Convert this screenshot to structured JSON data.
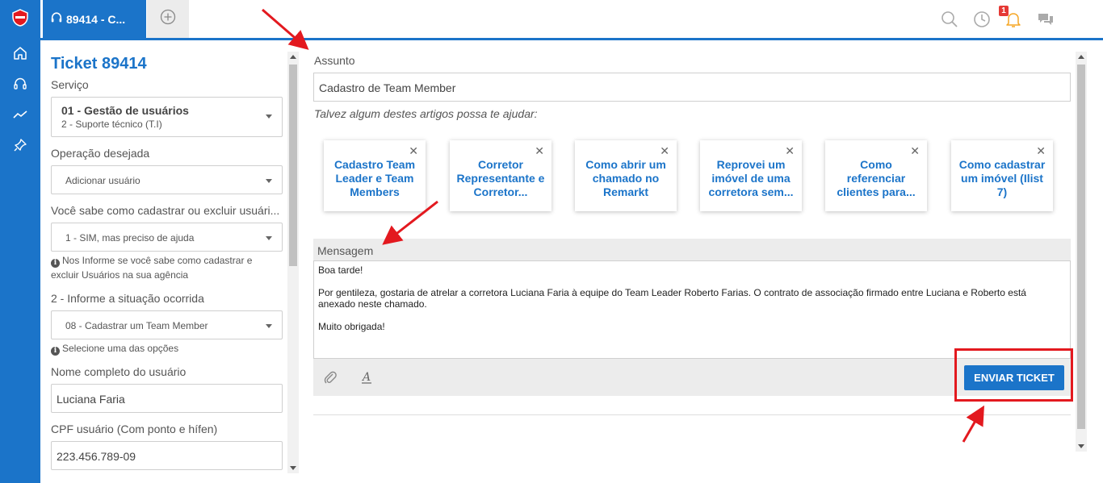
{
  "colors": {
    "brand": "#1b74c9",
    "annotation": "#e3191f",
    "badge": "#e53935"
  },
  "rail": {
    "items": [
      {
        "name": "home-icon"
      },
      {
        "name": "headset-icon"
      },
      {
        "name": "trending-icon"
      },
      {
        "name": "pin-icon"
      }
    ]
  },
  "tabs": {
    "active_label": "89414 - C...",
    "add_icon": "plus-circle-icon"
  },
  "header": {
    "icons": [
      "search-icon",
      "clock-icon",
      "bell-icon",
      "chat-icon"
    ],
    "notification_count": "1"
  },
  "form": {
    "title": "Ticket 89414",
    "servico_label": "Serviço",
    "servico_value": "01 - Gestão de usuários",
    "servico_sub": "2 - Suporte técnico (T.I)",
    "operacao_label": "Operação desejada",
    "operacao_value": "Adicionar usuário",
    "sabe_label": "Você sabe como cadastrar ou excluir usuári...",
    "sabe_value": "1 - SIM, mas preciso de ajuda",
    "sabe_hint": "Nos Informe se você sabe como cadastrar e excluir Usuários na sua agência",
    "situacao_label": "2 - Informe a situação ocorrida",
    "situacao_value": "08 - Cadastrar um Team Member",
    "situacao_hint": "Selecione uma das opções",
    "nome_label": "Nome completo do usuário",
    "nome_value": "Luciana Faria",
    "cpf_label": "CPF usuário (Com ponto e hífen)",
    "cpf_value": "223.456.789-09"
  },
  "main": {
    "assunto_label": "Assunto",
    "assunto_value": "Cadastro de Team Member",
    "help_text": "Talvez algum destes artigos possa te ajudar:",
    "articles": [
      {
        "title": "Cadastro Team Leader e Team Members"
      },
      {
        "title": "Corretor Representante e Corretor..."
      },
      {
        "title": "Como abrir um chamado no Remarkt"
      },
      {
        "title": "Reprovei um imóvel de uma corretora sem..."
      },
      {
        "title": "Como referenciar clientes para..."
      },
      {
        "title": "Como cadastrar um imóvel (Ilist 7)"
      }
    ],
    "mensagem_label": "Mensagem",
    "message": {
      "greeting": "Boa tarde!",
      "body": "Por gentileza, gostaria de atrelar a corretora Luciana Faria à equipe do Team Leader Roberto Farias. O contrato de associação firmado entre Luciana e Roberto está anexado neste chamado.",
      "closing": "Muito obrigada!"
    },
    "toolbar": {
      "attach_icon": "paperclip-icon",
      "format_icon": "text-format-icon"
    },
    "send_label": "ENVIAR TICKET"
  }
}
